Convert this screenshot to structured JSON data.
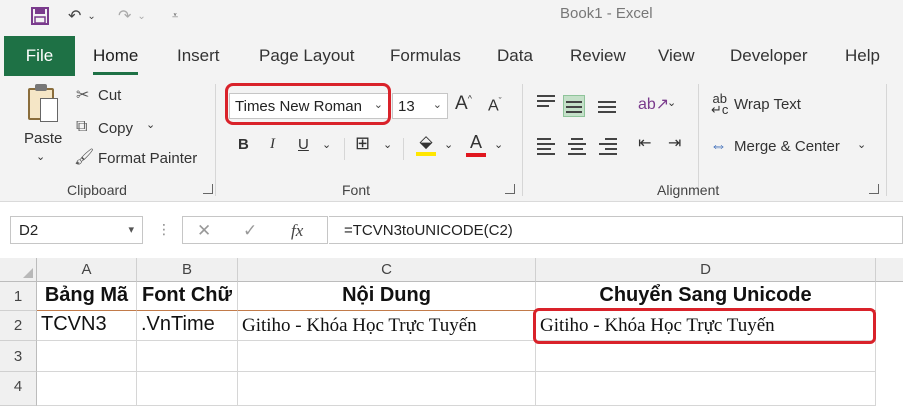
{
  "window": {
    "title": "Book1  -  Excel"
  },
  "tabs": [
    "File",
    "Home",
    "Insert",
    "Page Layout",
    "Formulas",
    "Data",
    "Review",
    "View",
    "Developer",
    "Help"
  ],
  "clipboard": {
    "paste": "Paste",
    "cut": "Cut",
    "copy": "Copy",
    "format_painter": "Format Painter",
    "label": "Clipboard"
  },
  "font": {
    "name": "Times New Roman",
    "size": "13",
    "bold": "B",
    "italic": "I",
    "underline": "U",
    "label": "Font",
    "grow": "A",
    "shrink": "A",
    "color_letter": "A"
  },
  "alignment": {
    "wrap_text": "Wrap Text",
    "merge_center": "Merge & Center",
    "label": "Alignment"
  },
  "formula_bar": {
    "name_box": "D2",
    "fx": "fx",
    "formula": "=TCVN3toUNICODE(C2)"
  },
  "columns": [
    "A",
    "B",
    "C",
    "D"
  ],
  "rows": [
    "1",
    "2",
    "3",
    "4"
  ],
  "cells": {
    "a1": "Bảng Mã",
    "b1": "Font Chữ",
    "c1": "Nội Dung",
    "d1": "Chuyển Sang Unicode",
    "a2": "TCVN3",
    "b2": ".VnTime",
    "c2": "Gitiho - Khóa Học Trực Tuyến",
    "d2": "Gitiho - Khóa Học Trực Tuyến"
  },
  "colors": {
    "accent": "#1e7145",
    "highlight": "#d9222a"
  }
}
